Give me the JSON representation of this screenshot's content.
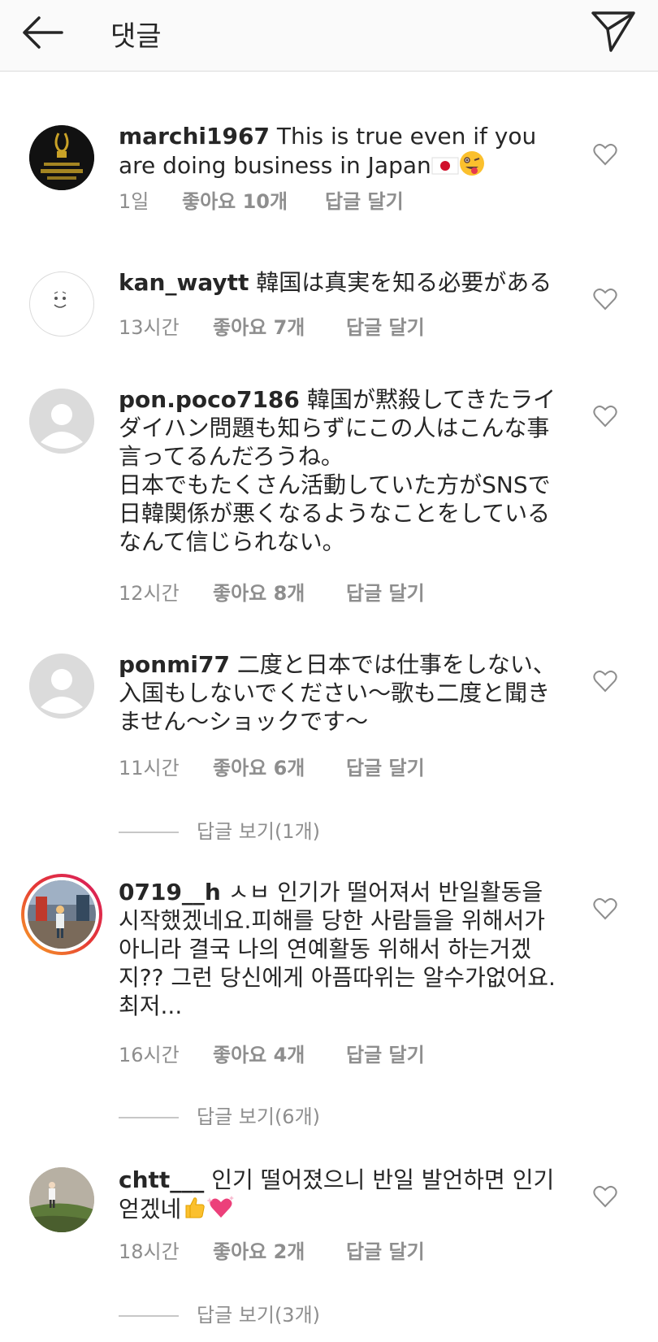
{
  "header": {
    "title": "댓글"
  },
  "comments": [
    {
      "username": "marchi1967",
      "text": "This is true even if you are doing business in Japan",
      "time": "1일",
      "likes": "좋아요 10개",
      "reply": "답글 달기"
    },
    {
      "username": "kan_waytt",
      "text": "韓国は真実を知る必要がある",
      "time": "13시간",
      "likes": "좋아요 7개",
      "reply": "답글 달기"
    },
    {
      "username": "pon.poco7186",
      "text": "韓国が黙殺してきたライダイハン問題も知らずにこの人はこんな事言ってるんだろうね。\n日本でもたくさん活動していた方がSNSで日韓関係が悪くなるようなことをしているなんて信じられない。",
      "time": "12시간",
      "likes": "좋아요 8개",
      "reply": "답글 달기"
    },
    {
      "username": "ponmi77",
      "text": "二度と日本では仕事をしない、入国もしないでください〜歌も二度と聞きません〜ショックです〜",
      "time": "11시간",
      "likes": "좋아요 6개",
      "reply": "답글 달기",
      "view_replies": "답글 보기(1개)"
    },
    {
      "username": "0719__h",
      "text": "ㅅㅂ 인기가 떨어져서 반일활동을 시작했겠네요.피해를 당한 사람들을 위해서가 아니라 결국 나의 연예활동 위해서 하는거겠지?? 그런 당신에게 아픔따위는 알수가없어요.  최저...",
      "time": "16시간",
      "likes": "좋아요 4개",
      "reply": "답글 달기",
      "view_replies": "답글 보기(6개)"
    },
    {
      "username": "chtt___",
      "text": "인기 떨어졌으니 반일 발언하면 인기 얻겠네",
      "time": "18시간",
      "likes": "좋아요 2개",
      "reply": "답글 달기",
      "view_replies": "답글 보기(3개)"
    }
  ],
  "icons": {
    "back": "arrow-left-icon",
    "send": "paper-plane-icon",
    "heart": "heart-outline-icon",
    "flag": "japan-flag-emoji",
    "face": "winking-tongue-face-emoji",
    "thumb": "thumbs-up-emoji",
    "sparkle_heart": "sparkling-heart-emoji"
  },
  "colors": {
    "text": "#262626",
    "meta": "#8e8e8e",
    "story_ring_start": "#f9a825",
    "story_ring_end": "#d81b60"
  }
}
